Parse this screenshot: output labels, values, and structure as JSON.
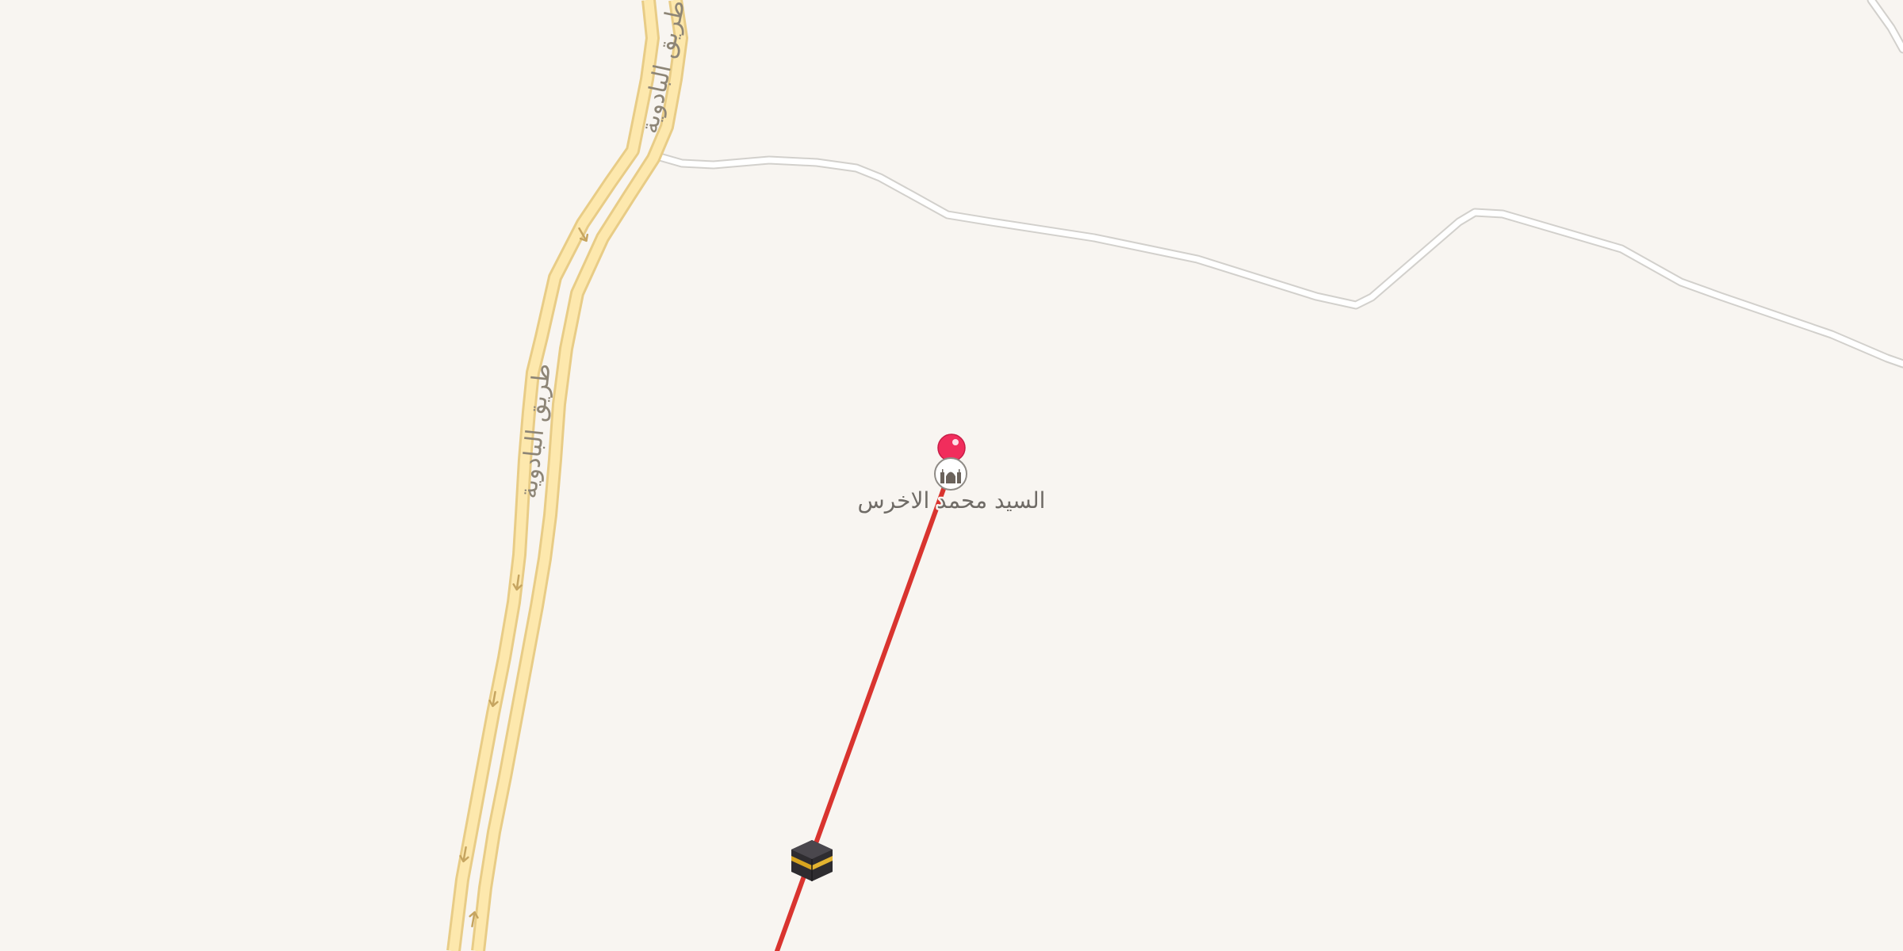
{
  "map": {
    "background_color": "#f8f5f1",
    "highway": {
      "name": "طريق البادوية",
      "name_segment_top": "طريق البادوية",
      "color_fill": "#fde8ad",
      "color_edge": "#e8cc86",
      "direction_arrows": [
        "down",
        "down",
        "down",
        "down",
        "up"
      ]
    },
    "minor_road": {
      "color_fill": "#ffffff",
      "color_edge": "#d2d0cc"
    },
    "qibla_line": {
      "color": "#d9342f"
    },
    "pin": {
      "color": "#f12d5c",
      "icon": "mosque-icon"
    },
    "poi": {
      "label": "السيد محمد الاخرس",
      "icon": "mosque-icon"
    },
    "kaaba_marker": {
      "icon": "kaaba-icon"
    }
  }
}
